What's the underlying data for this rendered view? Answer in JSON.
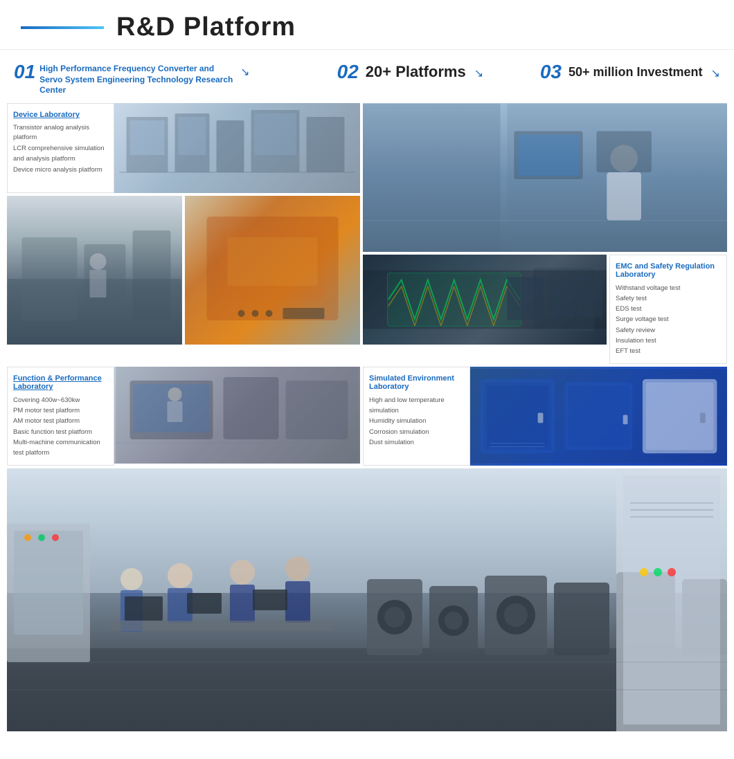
{
  "header": {
    "title": "R&D Platform",
    "line_color": "#1a6bbf"
  },
  "section_badges": [
    {
      "number": "01",
      "text": "High Performance Frequency Converter and Servo System Engineering Technology Research Center",
      "has_arrow": true
    },
    {
      "number": "02",
      "text": "20+ Platforms",
      "has_arrow": true
    },
    {
      "number": "03",
      "text": "50+ million Investment",
      "has_arrow": true
    }
  ],
  "device_lab": {
    "title": "Device Laboratory",
    "items": [
      "Transistor analog analysis platform",
      "LCR comprehensive simulation and analysis platform",
      "Device micro analysis platform"
    ]
  },
  "emc_lab": {
    "title": "EMC and Safety Regulation Laboratory",
    "items": [
      "Withstand voltage test",
      "Safety test",
      "EDS test",
      "Surge voltage test",
      "Safety review",
      "Insulation test",
      "EFT test"
    ]
  },
  "func_lab": {
    "title": "Function & Performance Laboratory",
    "items": [
      "Covering 400w~630kw",
      "PM motor test platform",
      "AM motor test platform",
      "Basic function test platform",
      "Multi-machine communication test platform"
    ]
  },
  "sim_lab": {
    "title": "Simulated Environment Laboratory",
    "items": [
      "High and low temperature simulation",
      "Humidity simulation",
      "Corrosion simulation",
      "Dust simulation"
    ]
  }
}
